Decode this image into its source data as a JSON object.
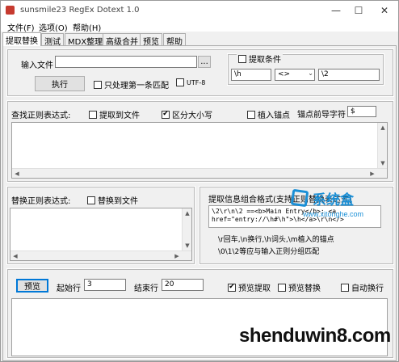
{
  "window": {
    "title": "sunsmile23 RegEx Dotext 1.0",
    "minimize_glyph": "—",
    "maximize_glyph": "☐",
    "close_glyph": "✕"
  },
  "menu": [
    "文件(F)",
    "选项(O)",
    "帮助(H)"
  ],
  "tabs": [
    "提取替换",
    "测试",
    "MDX整理",
    "高级合并",
    "预览",
    "帮助"
  ],
  "input_file": {
    "label": "输入文件",
    "value": "",
    "browse_label": "...",
    "execute_label": "执行",
    "first_match_only_label": "只处理第一条匹配",
    "utf8_label": "UTF-8"
  },
  "extract_condition": {
    "label": "提取条件",
    "field1": "\\h",
    "operator": "<>",
    "field2": "\\2"
  },
  "find_regex": {
    "label": "查找正则表达式:",
    "extract_to_file_label": "提取到文件",
    "case_sensitive_label": "区分大小写",
    "insert_anchor_label": "植入锚点",
    "anchor_prefix_label": "锚点前导字符",
    "anchor_prefix_value": "$",
    "content": ""
  },
  "replace_regex": {
    "label": "替换正则表达式:",
    "replace_to_file_label": "替换到文件",
    "content": ""
  },
  "extract_format": {
    "label": "提取信息组合格式(支持正则替换表达式)",
    "content_line1": "\\2\\r\\n\\2 ==<b>Main Entry</b>: <a",
    "content_line2": "href=\"entry://\\h#\\h\">\\h</a>\\r\\n</>",
    "hint1": "\\r回车,\\n换行,\\h词头,\\m植入的锚点",
    "hint2": "\\0\\1\\2等应与输入正则分组匹配"
  },
  "preview": {
    "button_label": "预览",
    "start_row_label": "起始行",
    "start_row_value": "3",
    "end_row_label": "结束行",
    "end_row_value": "20",
    "preview_extract_label": "预览提取",
    "preview_replace_label": "预览替换",
    "auto_wrap_label": "自动换行",
    "content": ""
  },
  "watermark": {
    "site_logo": "系统盒",
    "site_url": "www.xitonghe.com",
    "bottom_text": "shenduwin8.com"
  },
  "checkbox_states": {
    "extract_condition": false,
    "first_match_only": false,
    "utf8": false,
    "extract_to_file": false,
    "case_sensitive": true,
    "insert_anchor": false,
    "replace_to_file": false,
    "preview_extract": true,
    "preview_replace": false,
    "auto_wrap": false
  },
  "colors": {
    "window_bg": "#f0f0f0",
    "accent": "#0078d7",
    "watermark_blue": "#1a8fd6"
  }
}
